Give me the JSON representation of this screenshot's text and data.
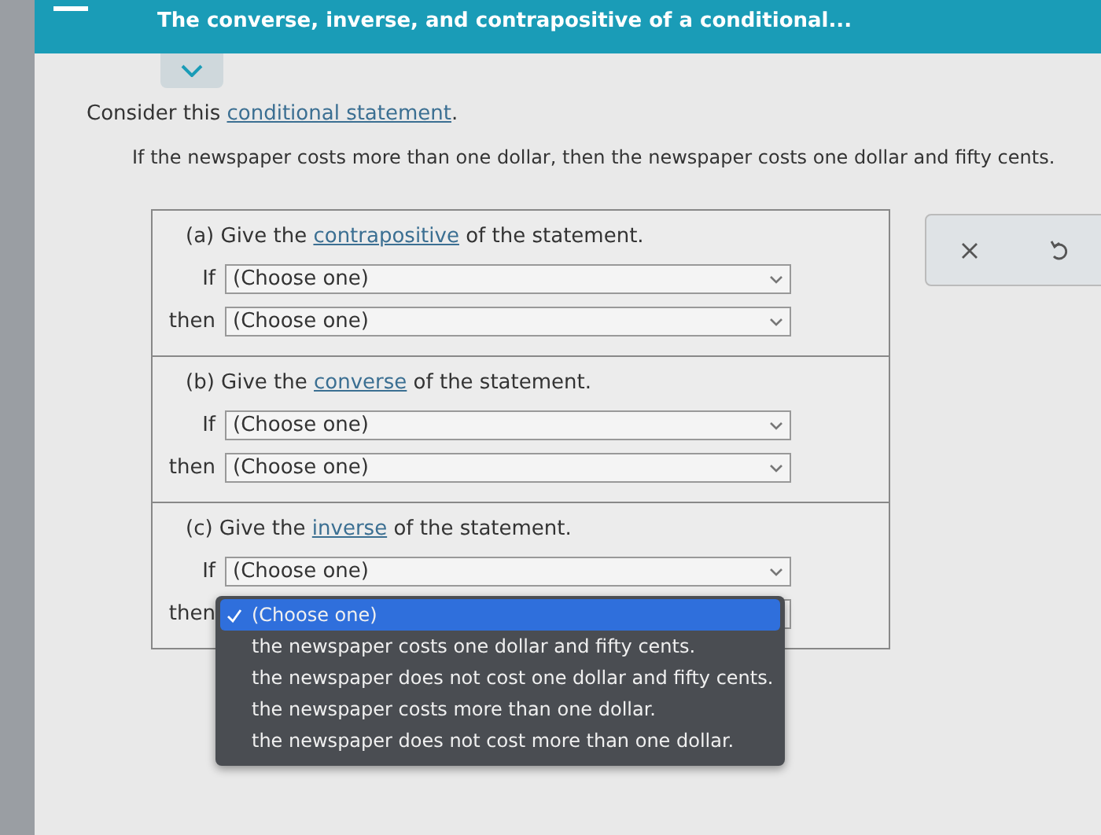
{
  "header": {
    "title": "The converse, inverse, and contrapositive of a conditional..."
  },
  "intro": {
    "before": "Consider this ",
    "link": "conditional statement",
    "after": "."
  },
  "statement": "If the newspaper costs more than one dollar, then the newspaper costs one dollar and fifty cents.",
  "parts": [
    {
      "before": "(a) Give the ",
      "link": "contrapositive",
      "after": " of the statement.",
      "rows": [
        {
          "lead": "If",
          "value": "(Choose one)"
        },
        {
          "lead": "then",
          "value": "(Choose one)"
        }
      ]
    },
    {
      "before": "(b) Give the ",
      "link": "converse",
      "after": " of the statement.",
      "rows": [
        {
          "lead": "If",
          "value": "(Choose one)"
        },
        {
          "lead": "then",
          "value": "(Choose one)"
        }
      ]
    },
    {
      "before": "(c) Give the ",
      "link": "inverse",
      "after": " of the statement.",
      "rows": [
        {
          "lead": "If",
          "value": "(Choose one)"
        },
        {
          "lead": "then",
          "open": true
        }
      ]
    }
  ],
  "dropdown": {
    "options": [
      {
        "label": "(Choose one)",
        "selected": true
      },
      {
        "label": "the newspaper costs one dollar and fifty cents.",
        "selected": false
      },
      {
        "label": "the newspaper does not cost one dollar and fifty cents.",
        "selected": false
      },
      {
        "label": "the newspaper costs more than one dollar.",
        "selected": false
      },
      {
        "label": "the newspaper does not cost more than one dollar.",
        "selected": false
      }
    ]
  }
}
